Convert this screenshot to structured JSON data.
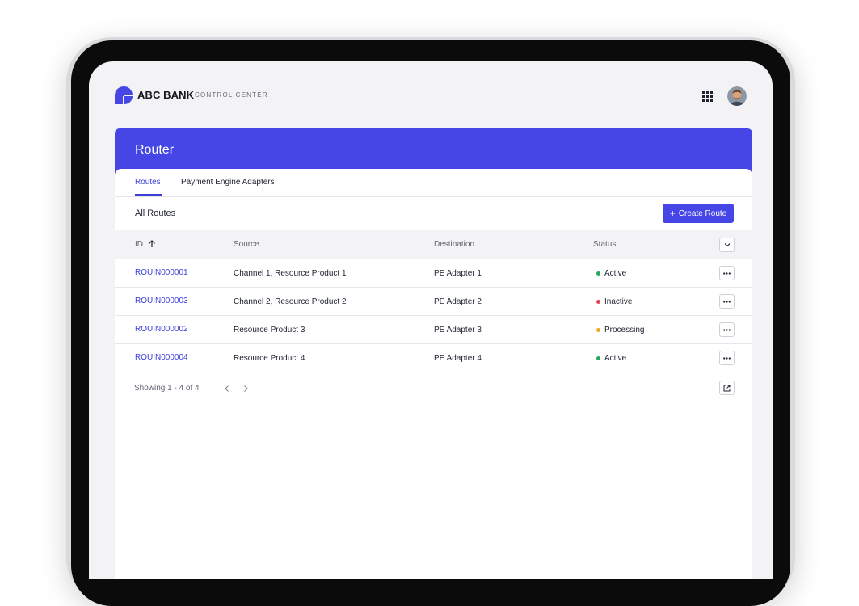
{
  "brand": {
    "name": "ABC BANK",
    "subtitle": "CONTROL CENTER",
    "logo_icon": "abc-bank-logo",
    "accent_color": "#4646e6"
  },
  "topbar": {
    "apps_icon": "apps-grid-icon",
    "avatar_icon": "user-avatar"
  },
  "page": {
    "title": "Router"
  },
  "tabs": [
    {
      "label": "Routes",
      "active": true
    },
    {
      "label": "Payment Engine Adapters",
      "active": false
    }
  ],
  "section": {
    "title": "All Routes",
    "create_button": "Create Route",
    "create_icon": "plus-icon"
  },
  "table": {
    "columns": [
      "ID",
      "Source",
      "Destination",
      "Status"
    ],
    "sort": {
      "column": "ID",
      "direction": "ascending",
      "icon": "arrow-up-icon"
    },
    "rows": [
      {
        "id": "ROUIN000001",
        "source": "Channel 1, Resource Product 1",
        "destination": "PE Adapter 1",
        "status": "Active",
        "status_color": "#2da55a"
      },
      {
        "id": "ROUIN000003",
        "source": "Channel 2, Resource Product 2",
        "destination": "PE Adapter 2",
        "status": "Inactive",
        "status_color": "#e2445c"
      },
      {
        "id": "ROUIN000002",
        "source": "Resource Product 3",
        "destination": "PE Adapter 3",
        "status": "Processing",
        "status_color": "#f0a81a"
      },
      {
        "id": "ROUIN000004",
        "source": "Resource Product 4",
        "destination": "PE Adapter 4",
        "status": "Active",
        "status_color": "#2da55a"
      }
    ]
  },
  "footer": {
    "showing": "Showing 1 - 4 of 4",
    "prev_icon": "chevron-left-icon",
    "next_icon": "chevron-right-icon",
    "export_icon": "export-icon"
  }
}
